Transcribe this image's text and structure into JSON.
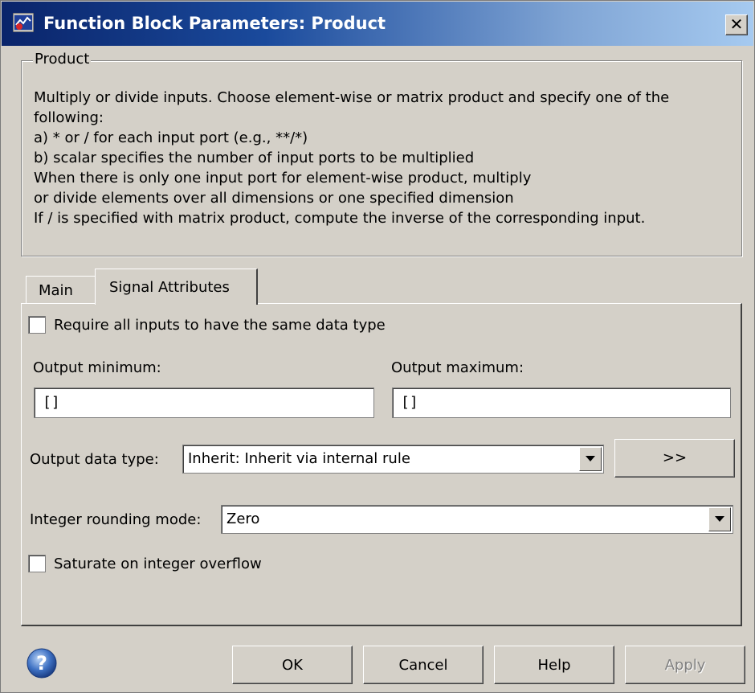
{
  "window": {
    "title": "Function Block Parameters: Product",
    "close_glyph": "✕"
  },
  "group": {
    "legend": "Product",
    "description": [
      "Multiply or divide inputs.  Choose element-wise or matrix product and specify one of the",
      "following:",
      "a) * or / for each input port (e.g., **/*)",
      "b) scalar specifies the number of input ports to be multiplied",
      "When there is only one input port for element-wise product, multiply",
      "or divide elements over all dimensions or one specified dimension",
      "If / is specified with matrix product, compute the inverse of the corresponding input."
    ]
  },
  "tabs": [
    {
      "label": "Main",
      "active": false
    },
    {
      "label": "Signal Attributes",
      "active": true
    }
  ],
  "signal": {
    "require_same_type": {
      "label": "Require all inputs to have the same data type",
      "checked": false
    },
    "output_min": {
      "label": "Output minimum:",
      "value": "[]"
    },
    "output_max": {
      "label": "Output maximum:",
      "value": "[]"
    },
    "output_data_type": {
      "label": "Output data type:",
      "value": "Inherit: Inherit via internal rule",
      "assistant_label": ">>"
    },
    "rounding_mode": {
      "label": "Integer rounding mode:",
      "value": "Zero"
    },
    "saturate": {
      "label": "Saturate on integer overflow",
      "checked": false
    }
  },
  "buttons": {
    "ok": "OK",
    "cancel": "Cancel",
    "help": "Help",
    "apply": "Apply"
  },
  "icons": {
    "title_icon": "simulink-block-icon",
    "help_icon": "question-circle-icon"
  },
  "colors": {
    "titlebar_start": "#0a246a",
    "titlebar_end": "#a6caf0",
    "face": "#d4d0c8"
  }
}
